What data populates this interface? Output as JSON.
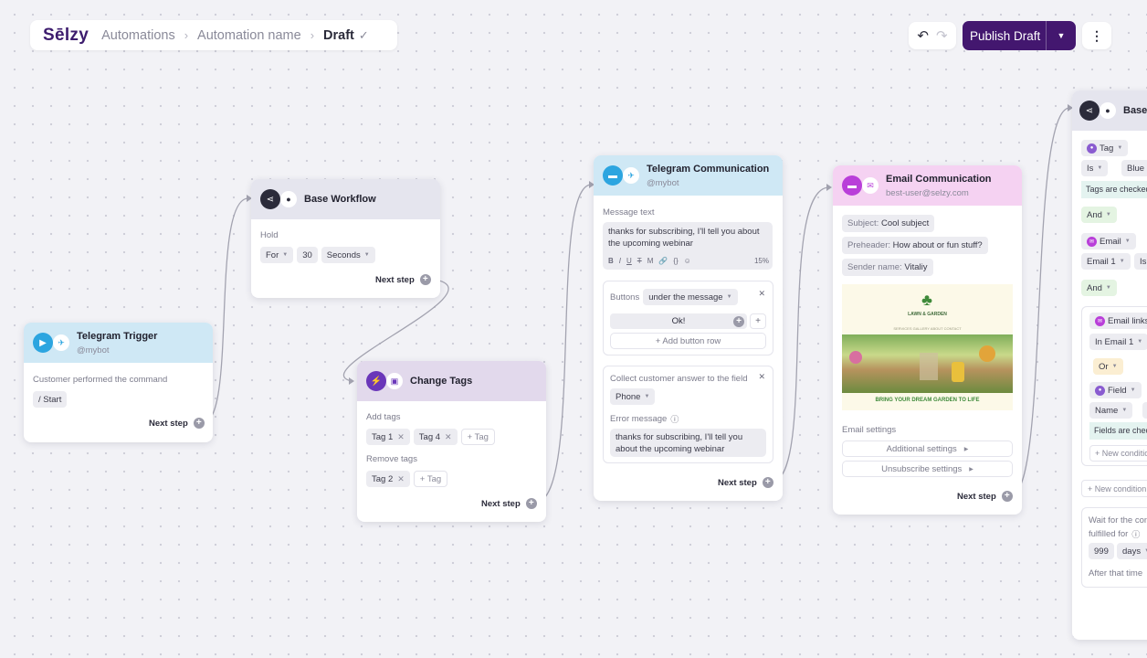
{
  "topbar": {
    "logo": "Sēlzy",
    "crumb1": "Automations",
    "crumb2": "Automation name",
    "crumb3": "Draft",
    "publish_label": "Publish Draft"
  },
  "colors": {
    "brand": "#43176f",
    "telegram": "#2ca5e0",
    "email": "#b93fd9",
    "tags": "#6a36b9"
  },
  "trigger": {
    "title": "Telegram Trigger",
    "subtitle": "@mybot",
    "label": "Customer performed the command",
    "command": "/ Start",
    "next": "Next step"
  },
  "base1": {
    "title": "Base Workflow",
    "hold_label": "Hold",
    "for": "For",
    "num": "30",
    "unit": "Seconds",
    "next": "Next step"
  },
  "tags": {
    "title": "Change Tags",
    "add_label": "Add tags",
    "add_items": [
      "Tag 1",
      "Tag 4"
    ],
    "tag_placeholder": "+ Tag",
    "remove_label": "Remove tags",
    "remove_items": [
      "Tag 2"
    ],
    "next": "Next step"
  },
  "telegram": {
    "title": "Telegram Communication",
    "subtitle": "@mybot",
    "msg_label": "Message text",
    "msg_text": "thanks for subscribing, I'll tell you about the upcoming webinar",
    "percent": "15%",
    "toolbar": [
      "B",
      "I",
      "U",
      "T",
      "M",
      "🔗",
      "{}",
      "☺"
    ],
    "buttons_label": "Buttons",
    "buttons_pos": "under the message",
    "ok_button": "Ok!",
    "add_button": "+ Add button row",
    "collect_label": "Collect customer answer to the field",
    "field": "Phone",
    "error_label": "Error message",
    "error_text": "thanks for subscribing, I'll tell you about the upcoming webinar",
    "next": "Next step"
  },
  "email": {
    "title": "Email Communication",
    "subtitle": "best-user@selzy.com",
    "subject_label": "Subject:",
    "subject": "Cool subject",
    "preheader_label": "Preheader:",
    "preheader": "How about or fun stuff?",
    "sender_label": "Sender name:",
    "sender": "Vitaliy",
    "preview_brand": "LAWN & GARDEN",
    "preview_nav": "SERVICES  GALLERY  ABOUT  CONTACT",
    "preview_tagline": "BRING YOUR DREAM GARDEN TO LIFE",
    "settings_label": "Email settings",
    "additional": "Additional settings",
    "unsubscribe": "Unsubscribe settings",
    "next": "Next step"
  },
  "base2": {
    "title": "Base",
    "cond1_field": "Tag",
    "cond1_op": "Is",
    "cond1_val": "Blue",
    "cond1_note": "Tags are checked",
    "and1": "And",
    "cond2_field": "Email",
    "cond2_sub": "Email 1",
    "cond2_op": "Is",
    "and2": "And",
    "group_title": "Email links",
    "group_in": "In Email 1",
    "or": "Or",
    "field_label": "Field",
    "field_name": "Name",
    "field_op": "E",
    "field_note": "Fields are checked",
    "new_cond_inner": "+ New condition",
    "new_cond": "+ New condition",
    "wait1": "Wait for the condition",
    "wait2": "fulfilled for",
    "wait_num": "999",
    "wait_unit": "days",
    "after": "After that time"
  }
}
